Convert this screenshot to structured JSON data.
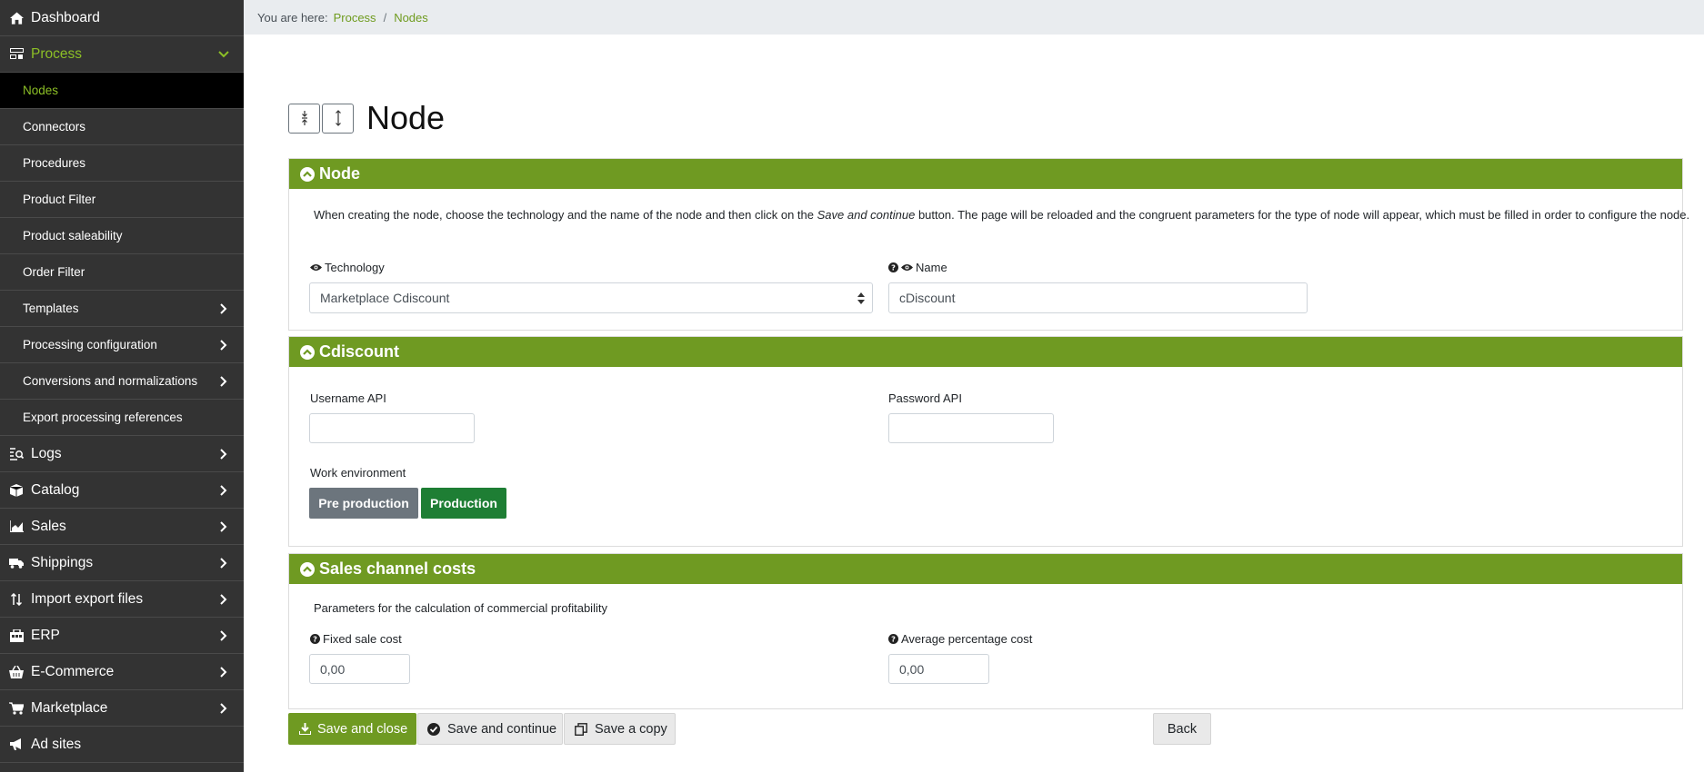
{
  "sidebar": {
    "items": [
      {
        "label": "Dashboard",
        "icon": "home-icon"
      },
      {
        "label": "Process",
        "icon": "process-icon"
      },
      {
        "label": "Nodes"
      },
      {
        "label": "Connectors"
      },
      {
        "label": "Procedures"
      },
      {
        "label": "Product Filter"
      },
      {
        "label": "Product saleability"
      },
      {
        "label": "Order Filter"
      },
      {
        "label": "Templates"
      },
      {
        "label": "Processing configuration"
      },
      {
        "label": "Conversions and normalizations"
      },
      {
        "label": "Export processing references"
      },
      {
        "label": "Logs",
        "icon": "logs-icon"
      },
      {
        "label": "Catalog",
        "icon": "box-icon"
      },
      {
        "label": "Sales",
        "icon": "chart-icon"
      },
      {
        "label": "Shippings",
        "icon": "truck-icon"
      },
      {
        "label": "Import export files",
        "icon": "sort-icon"
      },
      {
        "label": "ERP",
        "icon": "erp-icon"
      },
      {
        "label": "E-Commerce",
        "icon": "basket-icon"
      },
      {
        "label": "Marketplace",
        "icon": "cart-icon"
      },
      {
        "label": "Ad sites",
        "icon": "megaphone-icon"
      }
    ]
  },
  "breadcrumb": {
    "prefix": "You are here:",
    "items": [
      "Process",
      "Nodes"
    ],
    "separator": "/"
  },
  "page": {
    "title": "Node"
  },
  "node_card": {
    "title": "Node",
    "description_before": "When creating the node, choose the technology and the name of the node and then click on the ",
    "description_emphasis": "Save and continue",
    "description_after": " button. The page will be reloaded and the congruent parameters for the type of node will appear, which must be filled in order to configure the node.",
    "technology_label": "Technology",
    "technology_value": "Marketplace Cdiscount",
    "name_label": "Name",
    "name_value": "cDiscount"
  },
  "cdiscount_card": {
    "title": "Cdiscount",
    "username_label": "Username API",
    "username_value": "",
    "password_label": "Password API",
    "password_value": "",
    "env_label": "Work environment",
    "env_options": [
      "Pre production",
      "Production"
    ],
    "env_selected": "Production"
  },
  "costs_card": {
    "title": "Sales channel costs",
    "description": "Parameters for the calculation of commercial profitability",
    "fixed_label": "Fixed sale cost",
    "fixed_value": "0,00",
    "avg_label": "Average percentage cost",
    "avg_value": "0,00"
  },
  "footer": {
    "save_close": "Save and close",
    "save_continue": "Save and continue",
    "save_copy": "Save a copy",
    "back": "Back"
  },
  "colors": {
    "sidebar_bg": "#333333",
    "accent_green": "#6f9a22",
    "active_text": "#8cbf26",
    "production_green": "#1e7e34",
    "pre_production_gray": "#6c757d"
  }
}
